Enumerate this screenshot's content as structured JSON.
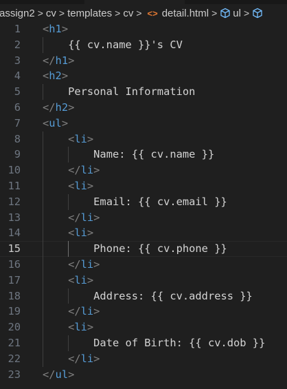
{
  "breadcrumb": {
    "items": [
      "assign2",
      "cv",
      "templates",
      "cv",
      "detail.html",
      "ul",
      ""
    ],
    "file_icon": "html-file-icon",
    "symbol_icon": "cube-icon"
  },
  "editor": {
    "current_line": 15,
    "lines": [
      {
        "n": "1",
        "indent": 0,
        "kind": "open",
        "tag": "h1"
      },
      {
        "n": "2",
        "indent": 1,
        "kind": "text",
        "text": "{{ cv.name }}'s CV"
      },
      {
        "n": "3",
        "indent": 0,
        "kind": "close",
        "tag": "h1"
      },
      {
        "n": "4",
        "indent": 0,
        "kind": "open",
        "tag": "h2"
      },
      {
        "n": "5",
        "indent": 1,
        "kind": "text",
        "text": "Personal Information"
      },
      {
        "n": "6",
        "indent": 0,
        "kind": "close",
        "tag": "h2"
      },
      {
        "n": "7",
        "indent": 0,
        "kind": "open",
        "tag": "ul"
      },
      {
        "n": "8",
        "indent": 1,
        "kind": "open",
        "tag": "li"
      },
      {
        "n": "9",
        "indent": 2,
        "kind": "text",
        "text": "Name: {{ cv.name }}"
      },
      {
        "n": "10",
        "indent": 1,
        "kind": "close",
        "tag": "li"
      },
      {
        "n": "11",
        "indent": 1,
        "kind": "open",
        "tag": "li"
      },
      {
        "n": "12",
        "indent": 2,
        "kind": "text",
        "text": "Email: {{ cv.email }}"
      },
      {
        "n": "13",
        "indent": 1,
        "kind": "close",
        "tag": "li"
      },
      {
        "n": "14",
        "indent": 1,
        "kind": "open",
        "tag": "li"
      },
      {
        "n": "15",
        "indent": 2,
        "kind": "text",
        "text": "Phone: {{ cv.phone }}"
      },
      {
        "n": "16",
        "indent": 1,
        "kind": "close",
        "tag": "li"
      },
      {
        "n": "17",
        "indent": 1,
        "kind": "open",
        "tag": "li"
      },
      {
        "n": "18",
        "indent": 2,
        "kind": "text",
        "text": "Address: {{ cv.address }}"
      },
      {
        "n": "19",
        "indent": 1,
        "kind": "close",
        "tag": "li"
      },
      {
        "n": "20",
        "indent": 1,
        "kind": "open",
        "tag": "li"
      },
      {
        "n": "21",
        "indent": 2,
        "kind": "text",
        "text": "Date of Birth: {{ cv.dob }}"
      },
      {
        "n": "22",
        "indent": 1,
        "kind": "close",
        "tag": "li"
      },
      {
        "n": "23",
        "indent": 0,
        "kind": "close",
        "tag": "ul"
      }
    ]
  }
}
